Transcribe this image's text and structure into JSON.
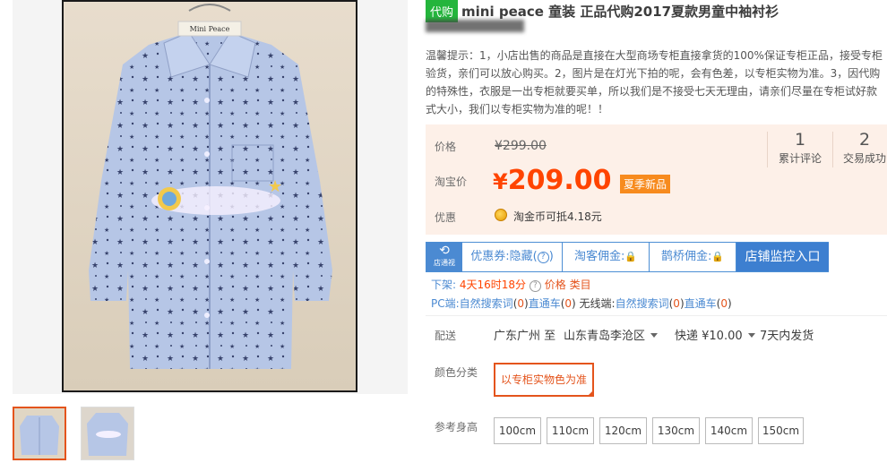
{
  "product": {
    "badge": "代购",
    "title": "mini peace 童装 正品代购2017夏款男童中袖衬衫"
  },
  "tips": {
    "text": "温馨提示：1，小店出售的商品是直接在大型商场专柜直接拿货的100%保证专柜正品，接受专柜验货，亲们可以放心购买。2，图片是在灯光下拍的呢，会有色差，以专柜实物为准。3，因代购的特殊性，衣服是一出专柜就要买单，所以我们是不接受七天无理由，请亲们尽量在专柜试好款式大小，我们以专柜实物为准的呢！！"
  },
  "price": {
    "orig_label": "价格",
    "orig_value": "¥299.00",
    "tb_label": "淘宝价",
    "currency": "¥",
    "tb_value": "209.00",
    "season_badge": "夏季新品",
    "promo_label": "优惠",
    "coin_text": "淘金币可抵4.18元"
  },
  "stats": {
    "reviews_count": "1",
    "reviews_label": "累计评论",
    "sales_count": "2",
    "sales_label": "交易成功"
  },
  "monitor": {
    "logo_text": "店通视",
    "coupon": "优惠券:隐藏(",
    "coupon_end": ")",
    "taoke": "淘客佣金:",
    "queqiao": "鹊桥佣金:",
    "shop_button": "店铺监控入口",
    "row1": {
      "offline_label": "下架:",
      "offline_value": "4天16时18分",
      "price_link": "价格",
      "category_link": "类目"
    },
    "row2": {
      "pc_label": "PC端:",
      "natural_search": "自然搜索词",
      "natural_count": "0",
      "through_train": "直通车",
      "through_count": "0",
      "wireless_label": "无线端:",
      "wl_natural_search": "自然搜索词",
      "wl_natural_count": "0",
      "wl_through_train": "直通车",
      "wl_through_count": "0"
    }
  },
  "shipping": {
    "label": "配送",
    "from": "广东广州 至",
    "to": "山东青岛李沧区",
    "express": "快递 ¥10.00",
    "dispatch": "7天内发货"
  },
  "sku": {
    "color_label": "颜色分类",
    "color_option": "以专柜实物色为准",
    "height_label": "参考身高",
    "sizes": [
      "100cm",
      "110cm",
      "120cm",
      "130cm",
      "140cm",
      "150cm"
    ]
  },
  "colors": {
    "accent": "#ff4400",
    "orange": "#e4541c",
    "blue": "#4b8ad2",
    "green": "#24b53c",
    "price_bg": "#fdf0e8"
  }
}
